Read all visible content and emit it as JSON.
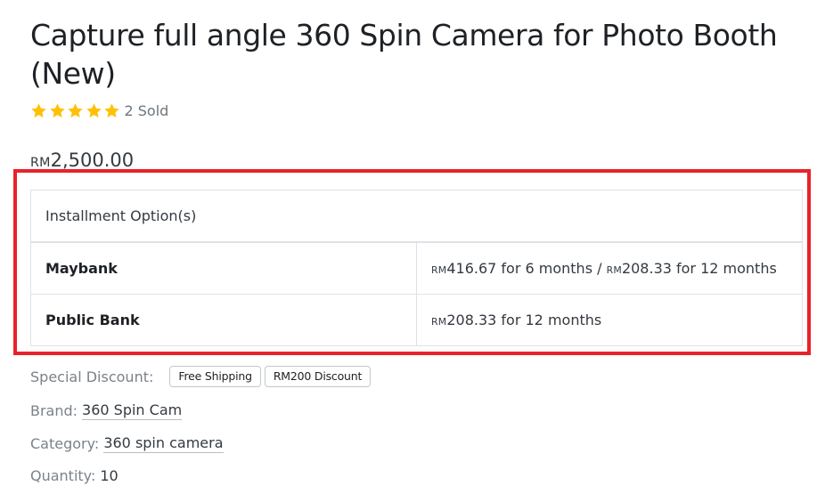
{
  "product": {
    "title": "Capture full angle 360 Spin Camera for Photo Booth (New)",
    "rating": {
      "stars": 5,
      "max_stars": 5,
      "star_color": "#ffc107",
      "sold_text": "2 Sold"
    },
    "price": {
      "currency": "RM",
      "amount": "2,500.00"
    }
  },
  "installment": {
    "header": "Installment Option(s)",
    "rows": [
      {
        "bank": "Maybank",
        "options": [
          {
            "currency": "RM",
            "amount": "416.67",
            "term": " for 6 months"
          },
          {
            "currency": "RM",
            "amount": "208.33",
            "term": " for 12 months"
          }
        ],
        "separator": " / "
      },
      {
        "bank": "Public Bank",
        "options": [
          {
            "currency": "RM",
            "amount": "208.33",
            "term": " for 12 months"
          }
        ]
      }
    ],
    "highlight_color": "#e8222b"
  },
  "details": {
    "special_discount_label": "Special Discount:",
    "discount_badges": [
      "Free Shipping",
      "RM200 Discount"
    ],
    "brand_label": "Brand:",
    "brand_value": "360 Spin Cam",
    "category_label": "Category:",
    "category_value": "360 spin camera",
    "quantity_label": "Quantity:",
    "quantity_value": "10"
  }
}
